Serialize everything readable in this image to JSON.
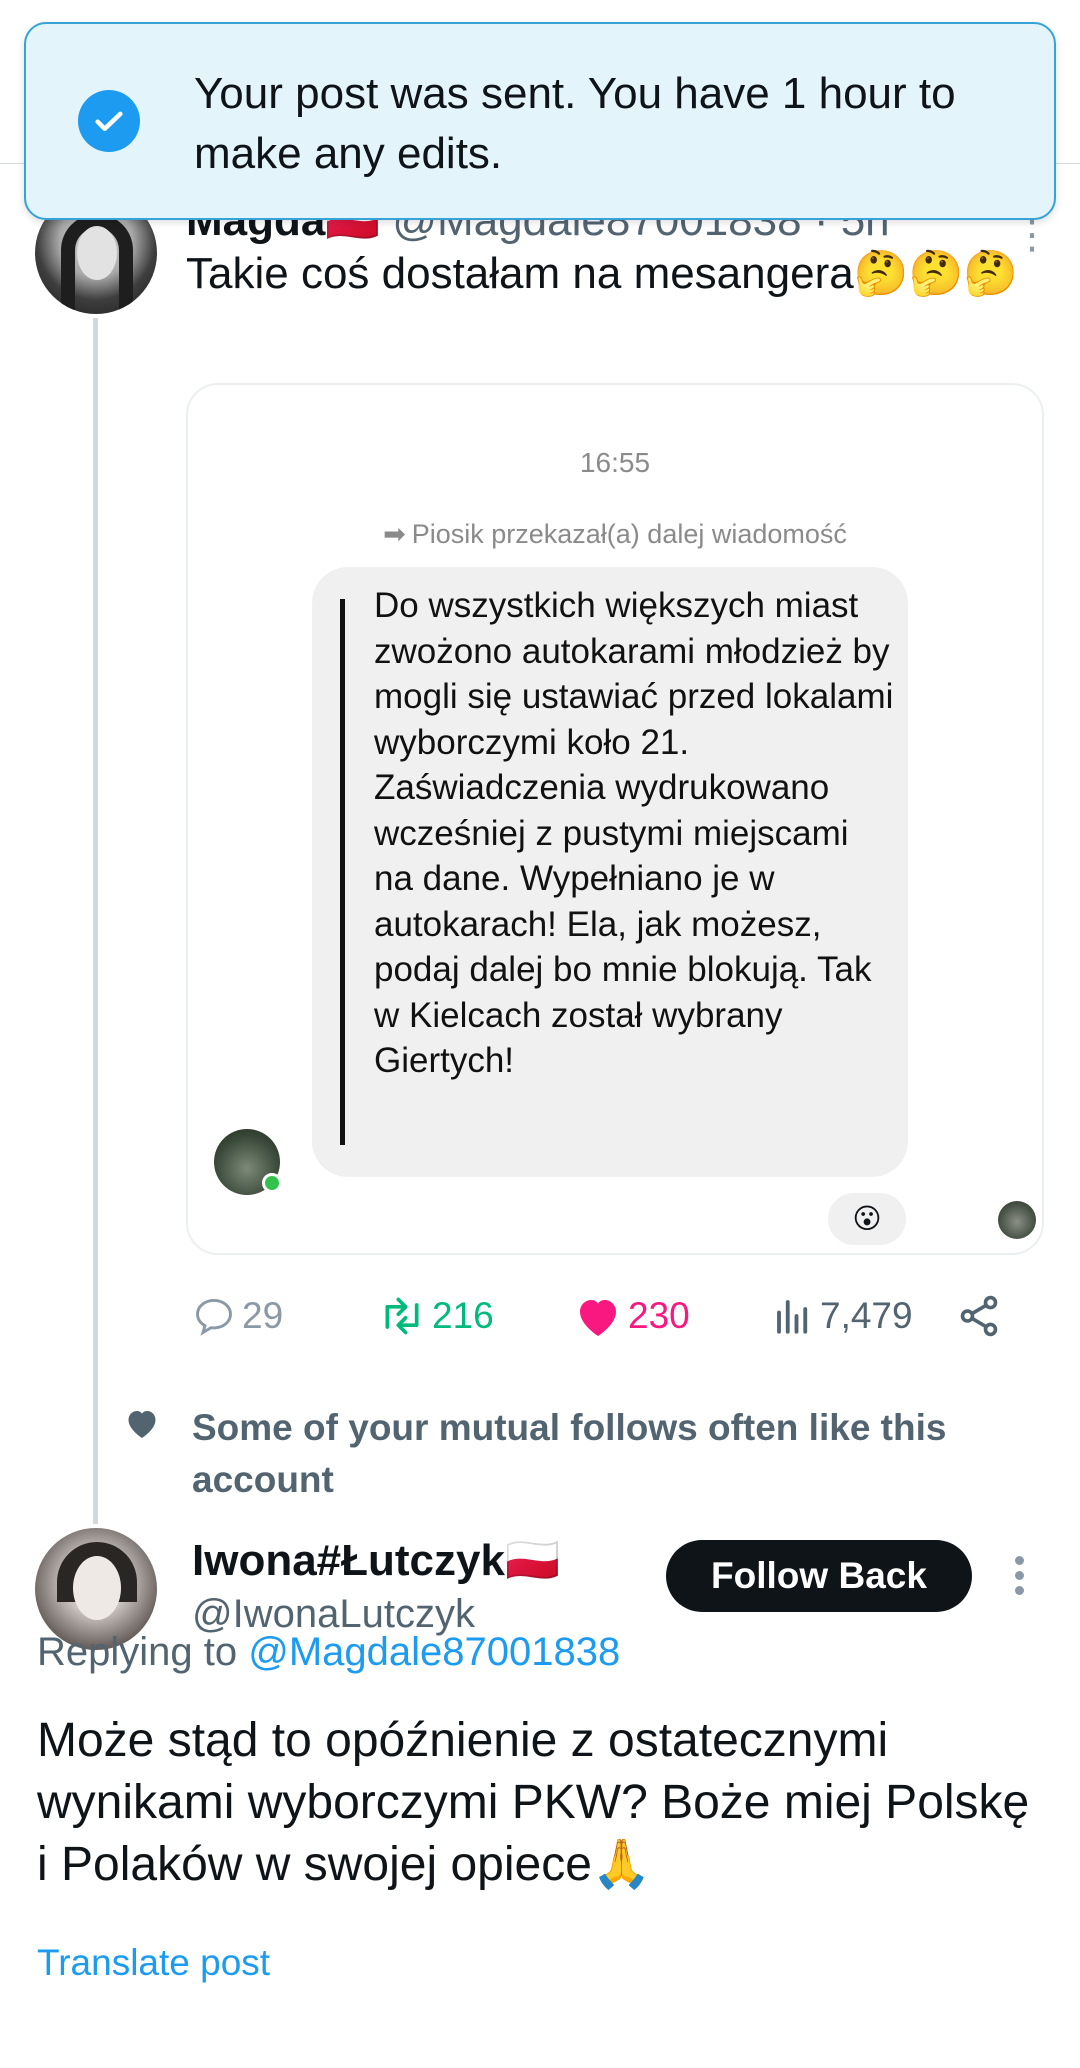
{
  "toast": {
    "message": "Your post was sent. You have 1 hour to make any edits.",
    "icon": "check-circle-icon",
    "accent": "#1d9bf0",
    "background": "#e4f4fb"
  },
  "tweet1": {
    "name": "Magda🇵🇱",
    "handle": "@Magdale87001838 · 5h",
    "text": "Takie coś dostałam na mesangera🤔🤔🤔",
    "embed": {
      "time": "16:55",
      "forwarded_label": "Piosik przekazał(a) dalej wiadomość",
      "message": "Do wszystkich większych miast zwożono autokarami młodzież by mogli się ustawiać przed lokalami wyborczymi koło 21. Zaświadczenia wydrukowano wcześniej z pustymi miejscami na dane. Wypełniano je w autokarach! Ela, jak możesz, podaj dalej bo mnie blokują. Tak w Kielcach został wybrany Giertych!",
      "reaction": "😮"
    },
    "stats": {
      "replies": "29",
      "reposts": "216",
      "likes": "230",
      "views": "7,479"
    },
    "colors": {
      "repost": "#00ba7c",
      "like": "#f91880"
    }
  },
  "social_context": {
    "text": "Some of your mutual follows often like this account"
  },
  "tweet2": {
    "name": "Iwona#Łutczyk🇵🇱",
    "handle": "@IwonaLutczyk",
    "follow_label": "Follow Back",
    "replying_prefix": "Replying to ",
    "replying_to": "@Magdale87001838",
    "text": "Może stąd to opóźnienie z ostatecznymi wynikami wyborczymi PKW? Boże miej Polskę i Polaków w swojej opiece🙏",
    "translate_label": "Translate post"
  }
}
